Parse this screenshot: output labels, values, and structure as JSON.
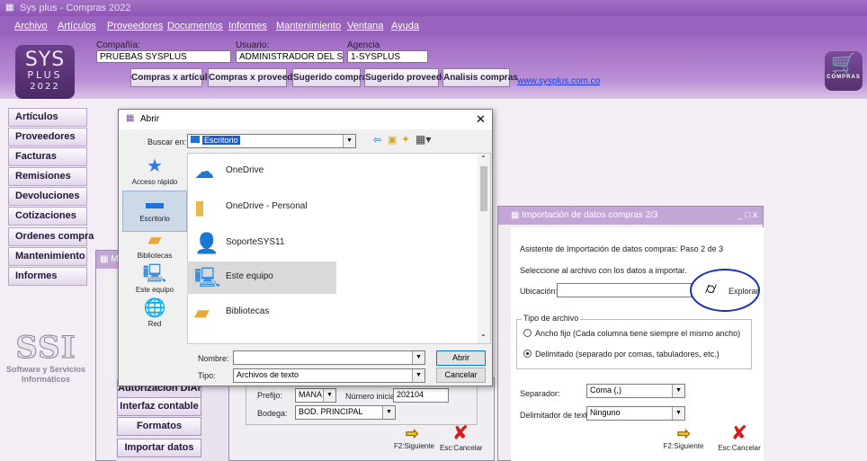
{
  "window": {
    "title": "Sys plus - Compras 2022"
  },
  "menu": [
    "Archivo",
    "Artículos",
    "Proveedores",
    "Documentos",
    "Informes",
    "Mantenimiento",
    "Ventana",
    "Ayuda"
  ],
  "logo": {
    "line1": "SYS",
    "line2": "PLUS",
    "year": "2022"
  },
  "header": {
    "company_label": "Compañía:",
    "company_value": "PRUEBAS SYSPLUS",
    "user_label": "Usuario:",
    "user_value": "ADMINISTRADOR DEL SISTEM.",
    "agency_label": "Agencia",
    "agency_value": "1-SYSPLUS",
    "buttons": [
      "Compras x artículo",
      "Compras x proveedor",
      "Sugerido compras",
      "Sugerido proveedor",
      "Analisis compras"
    ],
    "link": "www.sysplus.com.co",
    "cart_label": "COMPRAS"
  },
  "sidebar": {
    "items": [
      "Artículos",
      "Proveedores",
      "Facturas",
      "Remisiones",
      "Devoluciones",
      "Cotizaciones",
      "Ordenes compra",
      "Mantenimiento",
      "Informes"
    ]
  },
  "brand": {
    "logo_text": "SSI",
    "line1": "Software y Servicios",
    "line2": "Informáticos"
  },
  "mid_window": {
    "title_partial": "M",
    "buttons": [
      "Autorizacion DIAN",
      "Interfaz contable",
      "Formatos",
      "Importar datos"
    ]
  },
  "form": {
    "prefix_label": "Prefijo:",
    "prefix_value": "MANA",
    "initial_label": "Número inicial:",
    "initial_value": "202104",
    "warehouse_label": "Bodega:",
    "warehouse_value": "BOD. PRINCIPAL",
    "next_label": "F2:Siguiente",
    "cancel_label": "Esc:Cancelar"
  },
  "import_window": {
    "title": "Importación de datos compras 2/3",
    "window_controls": "_ □ x",
    "step": "Asistente de Importación de datos compras: Paso 2 de 3",
    "instruction": "Seleccione al archivo con los datos a importar.",
    "location_label": "Ubicación:",
    "location_value": "",
    "explore_label": "Explorar",
    "file_type_group": "Tipo de archivo",
    "fixed_width": "Ancho fijo (Cada columna tiene siempre el mismo ancho)",
    "delimited": "Delimitado (separado por comas, tabuladores, etc.)",
    "separator_label": "Separador:",
    "separator_value": "Coma (,)",
    "text_delim_label": "Delimitador de texto:",
    "text_delim_value": "Ninguno",
    "next_label": "F2:Siguiente",
    "cancel_label": "Esc:Cancelar",
    "highlight_color": "#1a2fb8"
  },
  "open_dialog": {
    "title": "Abrir",
    "lookin_label": "Buscar en:",
    "lookin_value": "Escritorio",
    "places": [
      "Acceso rápido",
      "Escritorio",
      "Bibliotecas",
      "Este equipo",
      "Red"
    ],
    "files": [
      "OneDrive",
      "OneDrive - Personal",
      "SoporteSYS11",
      "Este equipo",
      "Bibliotecas"
    ],
    "name_label": "Nombre:",
    "name_value": "",
    "type_label": "Tipo:",
    "type_value": "Archivos de texto",
    "open_button": "Abrir",
    "cancel_button": "Cancelar"
  }
}
